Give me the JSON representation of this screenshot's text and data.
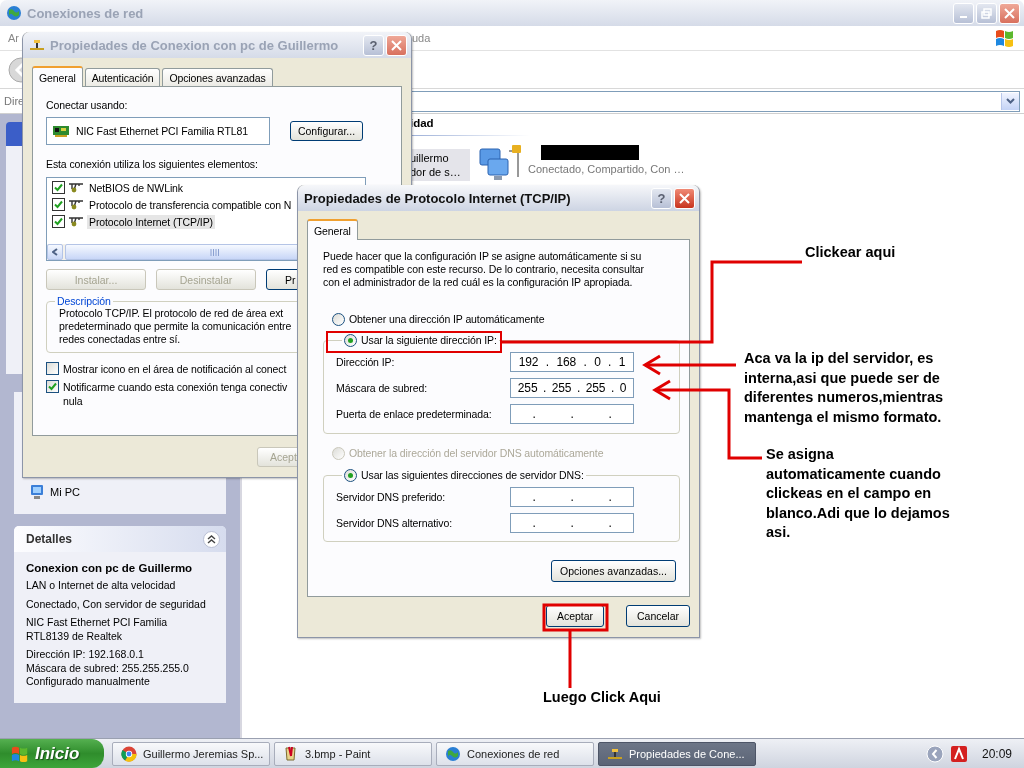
{
  "explorer_window": {
    "title": "Conexiones de red",
    "active": false,
    "menu_left_fragment": "Ar",
    "menu_right_fragment": "uda",
    "address_label": "Dire",
    "section_heading": "idad",
    "item_fragments": [
      "uillermo",
      "dor de s…"
    ],
    "item_status": "Conectado, Compartido, Con …",
    "places": [
      "Mi PC"
    ],
    "details": {
      "title": "Detalles",
      "expanded": true,
      "name": "Conexion con pc de Guillermo",
      "lines": [
        "LAN o Internet de alta velocidad",
        "Conectado, Con servidor de seguridad",
        "NIC Fast Ethernet PCI Familia\nRTL8139 de Realtek",
        "Dirección IP: 192.168.0.1\nMáscara de subred: 255.255.255.0\nConfigurado manualmente"
      ]
    }
  },
  "connection_dialog": {
    "title": "Propiedades de Conexion con pc de Guillermo",
    "active": false,
    "help_glyph": "?",
    "tabs": [
      {
        "label": "General",
        "selected": true
      },
      {
        "label": "Autenticación",
        "selected": false
      },
      {
        "label": "Opciones avanzadas",
        "selected": false
      }
    ],
    "connect_using_label": "Conectar usando:",
    "adapter": "NIC Fast Ethernet PCI Familia RTL81",
    "configure_button": "Configurar...",
    "components_label": "Esta conexión utiliza los siguientes elementos:",
    "components": [
      {
        "label": "NetBIOS de NWLink",
        "checked": true,
        "selected": false
      },
      {
        "label": "Protocolo de transferencia compatible con N",
        "checked": true,
        "selected": false
      },
      {
        "label": "Protocolo Internet (TCP/IP)",
        "checked": true,
        "selected": true
      }
    ],
    "buttons": [
      {
        "label": "Instalar...",
        "disabled": true
      },
      {
        "label": "Desinstalar",
        "disabled": true
      },
      {
        "label": "Pr",
        "disabled": false
      }
    ],
    "description": {
      "title": "Descripción",
      "text": "Protocolo TCP/IP. El protocolo de red de área ext\npredeterminado que permite la comunicación entre\nredes conectadas entre sí."
    },
    "options": [
      {
        "label": "Mostrar icono en el área de notificación al conect",
        "checked": false
      },
      {
        "label": "Notificarme cuando esta conexión tenga conectiv\nnula",
        "checked": true
      }
    ],
    "ok_button": "Acept"
  },
  "tcpip_dialog": {
    "title": "Propiedades de Protocolo Internet (TCP/IP)",
    "active": true,
    "help_glyph": "?",
    "tabs": [
      {
        "label": "General",
        "selected": true
      }
    ],
    "intro": "Puede hacer que la configuración IP se asigne automáticamente si su\nred es compatible con este recurso. De lo contrario, necesita consultar\ncon el administrador de la red cuál es la configuración IP apropiada.",
    "ip_modes": [
      {
        "label": "Obtener una dirección IP automáticamente",
        "selected": false,
        "disabled": false
      },
      {
        "label": "Usar la siguiente dirección IP:",
        "selected": true,
        "disabled": false
      }
    ],
    "ip_fields": [
      {
        "label": "Dirección IP:",
        "value": "192 . 168 . 0 . 1"
      },
      {
        "label": "Máscara de subred:",
        "value": "255 . 255 . 255 . 0"
      },
      {
        "label": "Puerta de enlace predeterminada:",
        "value": ". . ."
      }
    ],
    "dns_modes": [
      {
        "label": "Obtener la dirección del servidor DNS automáticamente",
        "selected": false,
        "disabled": true
      },
      {
        "label": "Usar las siguientes direcciones de servidor DNS:",
        "selected": true,
        "disabled": false
      }
    ],
    "dns_fields": [
      {
        "label": "Servidor DNS preferido:",
        "value": ". . ."
      },
      {
        "label": "Servidor DNS alternativo:",
        "value": ". . ."
      }
    ],
    "advanced_button": "Opciones avanzadas...",
    "ok_button": "Aceptar",
    "cancel_button": "Cancelar"
  },
  "annotations": {
    "click_here": "Clickear aqui",
    "ip_note": "Aca va la ip del servidor, es\ninterna,asi que puede ser de\ndiferentes numeros,mientras\nmantenga el mismo formato.",
    "auto_note": "Se asigna\nautomaticamente cuando\nclickeas en el campo en\nblanco.Adi que lo dejamos\nasi.",
    "then_click": "Luego Click Aqui"
  },
  "taskbar": {
    "start": "Inicio",
    "tasks": [
      {
        "label": "Guillermo Jeremias Sp...",
        "selected": false
      },
      {
        "label": "3.bmp - Paint",
        "selected": false
      },
      {
        "label": "Conexiones de red",
        "selected": false
      },
      {
        "label": "Propiedades de Cone...",
        "selected": true
      }
    ],
    "clock": "20:09"
  }
}
